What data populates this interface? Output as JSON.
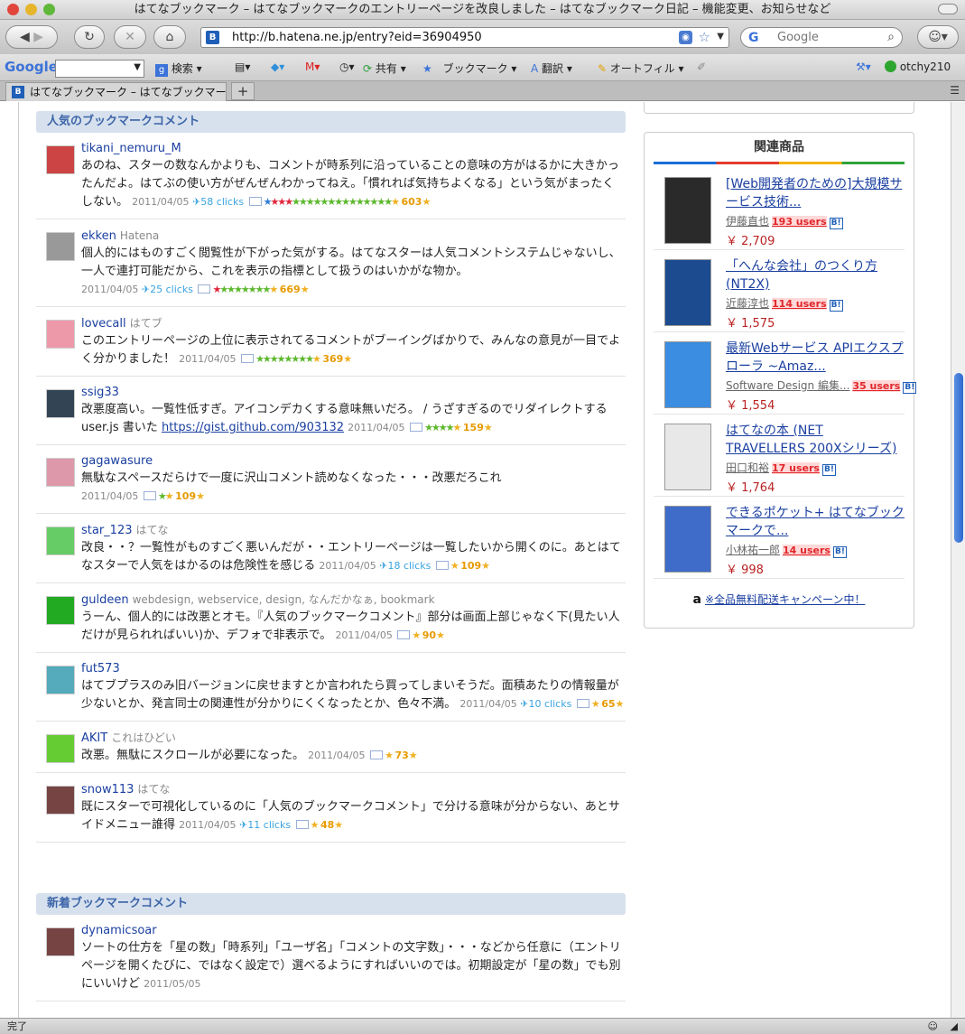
{
  "window": {
    "title": "はてなブックマーク – はてなブックマークのエントリーページを改良しました – はてなブックマーク日記 – 機能変更、お知らせなど"
  },
  "navbar": {
    "url": "http://b.hatena.ne.jp/entry?eid=36904950",
    "search_placeholder": "Google",
    "favicon": "B"
  },
  "google_toolbar": {
    "logo": "Google",
    "search_label": "検索",
    "share_label": "共有",
    "bookmark_label": "ブックマーク",
    "translate_label": "翻訳",
    "autofill_label": "オートフィル",
    "user": "otchy210"
  },
  "tabs": [
    {
      "label": "はてなブックマーク – はてなブックマーク..."
    }
  ],
  "status": "完了",
  "popular": {
    "heading": "人気のブックマークコメント",
    "comments": [
      {
        "user": "tikani_nemuru_M",
        "tags": "",
        "text": "あのね、スターの数なんかよりも、コメントが時系列に沿っていることの意味の方がはるかに大きかったんだよ。はてぶの使い方がぜんぜんわかってねえ。「慣れれば気持ちよくなる」という気がまったくしない。",
        "date": "2011/04/05",
        "clicks": "58 clicks",
        "stars": "603"
      },
      {
        "user": "ekken",
        "tags": "Hatena",
        "text": "個人的にはものすごく閲覧性が下がった気がする。はてなスターは人気コメントシステムじゃないし、一人で連打可能だから、これを表示の指標として扱うのはいかがな物か。",
        "date": "2011/04/05",
        "clicks": "25 clicks",
        "stars": "669"
      },
      {
        "user": "lovecall",
        "tags": "はてブ",
        "text": "このエントリーページの上位に表示されてるコメントがブーイングばかりで、みんなの意見が一目でよく分かりました！",
        "date": "2011/04/05",
        "clicks": "",
        "stars": "369"
      },
      {
        "user": "ssig33",
        "tags": "",
        "text": "改悪度高い。一覧性低すぎ。アイコンデカくする意味無いだろ。 / うざすぎるのでリダイレクトする user.js 書いた",
        "link": "https://gist.github.com/903132",
        "date": "2011/04/05",
        "clicks": "",
        "stars": "159"
      },
      {
        "user": "gagawasure",
        "tags": "",
        "text": "無駄なスペースだらけで一度に沢山コメント読めなくなった・・・改悪だろこれ",
        "date": "2011/04/05",
        "clicks": "",
        "stars": "109"
      },
      {
        "user": "star_123",
        "tags": "はてな",
        "text": "改良・・？一覧性がものすごく悪いんだが・・エントリーページは一覧したいから開くのに。あとはてなスターで人気をはかるのは危険性を感じる",
        "date": "2011/04/05",
        "clicks": "18 clicks",
        "stars": "109"
      },
      {
        "user": "guldeen",
        "tags": "webdesign, webservice, design, なんだかなぁ, bookmark",
        "text": "うーん、個人的には改悪とオモ。『人気のブックマークコメント』部分は画面上部じゃなく下(見たい人だけが見られればいい)か、デフォで非表示で。",
        "date": "2011/04/05",
        "clicks": "",
        "stars": "90"
      },
      {
        "user": "fut573",
        "tags": "",
        "text": "はてブプラスのみ旧バージョンに戻せますとか言われたら買ってしまいそうだ。面積あたりの情報量が少ないとか、発言同士の関連性が分かりにくくなったとか、色々不満。",
        "date": "2011/04/05",
        "clicks": "10 clicks",
        "stars": "65"
      },
      {
        "user": "AKIT",
        "tags": "これはひどい",
        "text": "改悪。無駄にスクロールが必要になった。",
        "date": "2011/04/05",
        "clicks": "",
        "stars": "73"
      },
      {
        "user": "snow113",
        "tags": "はてな",
        "text": "既にスターで可視化しているのに「人気のブックマークコメント」で分ける意味が分からない、あとサイドメニュー誰得",
        "date": "2011/04/05",
        "clicks": "11 clicks",
        "stars": "48"
      }
    ]
  },
  "recent": {
    "heading": "新着ブックマークコメント",
    "comments": [
      {
        "user": "dynamicsoar",
        "tags": "",
        "text": "ソートの仕方を「星の数」「時系列」「ユーザ名」「コメントの文字数」・・・などから任意に（エントリページを開くたびに、ではなく設定で）選べるようにすればいいのでは。初期設定が「星の数」でも別にいいけど",
        "date": "2011/05/05"
      }
    ]
  },
  "sidebar": {
    "title": "関連商品",
    "products": [
      {
        "title": "[Web開発者のための]大規模サービス技術...",
        "author": "伊藤直也",
        "users": "193 users",
        "price": "￥ 2,709",
        "badge": "B!"
      },
      {
        "title": "「へんな会社」のつくり方 (NT2X)",
        "author": "近藤淳也",
        "users": "114 users",
        "price": "￥ 1,575",
        "badge": "B!"
      },
      {
        "title": "最新Webサービス APIエクスプローラ ~Amaz...",
        "author": "Software Design 編集...",
        "users": "35 users",
        "price": "￥ 1,554",
        "badge": "B!"
      },
      {
        "title": "はてなの本 (NET TRAVELLERS 200Xシリーズ)",
        "author": "田口和裕",
        "users": "17 users",
        "price": "￥ 1,764",
        "badge": "B!"
      },
      {
        "title": "できるポケット+ はてなブックマークで...",
        "author": "小林祐一郎",
        "users": "14 users",
        "price": "￥ 998",
        "badge": "B!"
      }
    ],
    "amazon_logo": "a",
    "amazon_text": "※全品無料配送キャンペーン中！"
  }
}
